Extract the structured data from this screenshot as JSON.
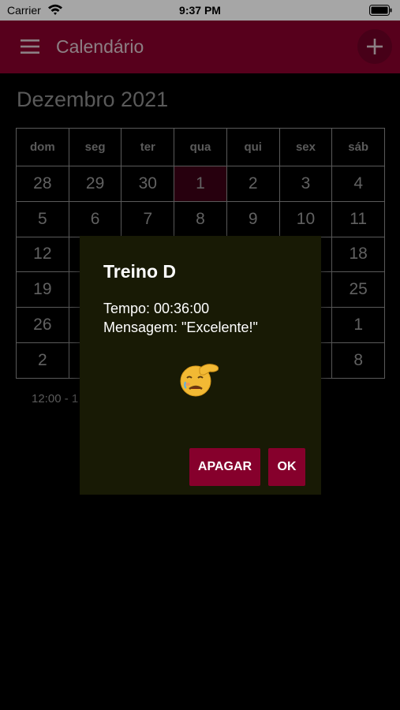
{
  "status_bar": {
    "carrier": "Carrier",
    "time": "9:37 PM"
  },
  "app_bar": {
    "title": "Calendário",
    "menu_icon": "hamburger-menu-icon",
    "add_icon": "plus-icon"
  },
  "calendar": {
    "month": "Dezembro 2021",
    "weekdays": [
      "dom",
      "seg",
      "ter",
      "qua",
      "qui",
      "sex",
      "sáb"
    ],
    "weeks": [
      [
        "28",
        "29",
        "30",
        "1",
        "2",
        "3",
        "4"
      ],
      [
        "5",
        "6",
        "7",
        "8",
        "9",
        "10",
        "11"
      ],
      [
        "12",
        "",
        "",
        "",
        "",
        "",
        "18"
      ],
      [
        "19",
        "",
        "",
        "",
        "",
        "",
        "25"
      ],
      [
        "26",
        "",
        "",
        "",
        "",
        "",
        "1"
      ],
      [
        "2",
        "",
        "",
        "",
        "",
        "",
        "8"
      ]
    ],
    "selected_day": "1",
    "event_time": "12:00 - 1"
  },
  "dialog": {
    "title": "Treino D",
    "time_line": "Tempo: 00:36:00",
    "message_line": "Mensagem: \"Excelente!\"",
    "emoji": "face-with-hand-over-forehead-icon",
    "delete_label": "APAGAR",
    "ok_label": "OK"
  },
  "colors": {
    "primary": "#86002c",
    "dialog_bg": "#181a05",
    "background": "#000000"
  }
}
